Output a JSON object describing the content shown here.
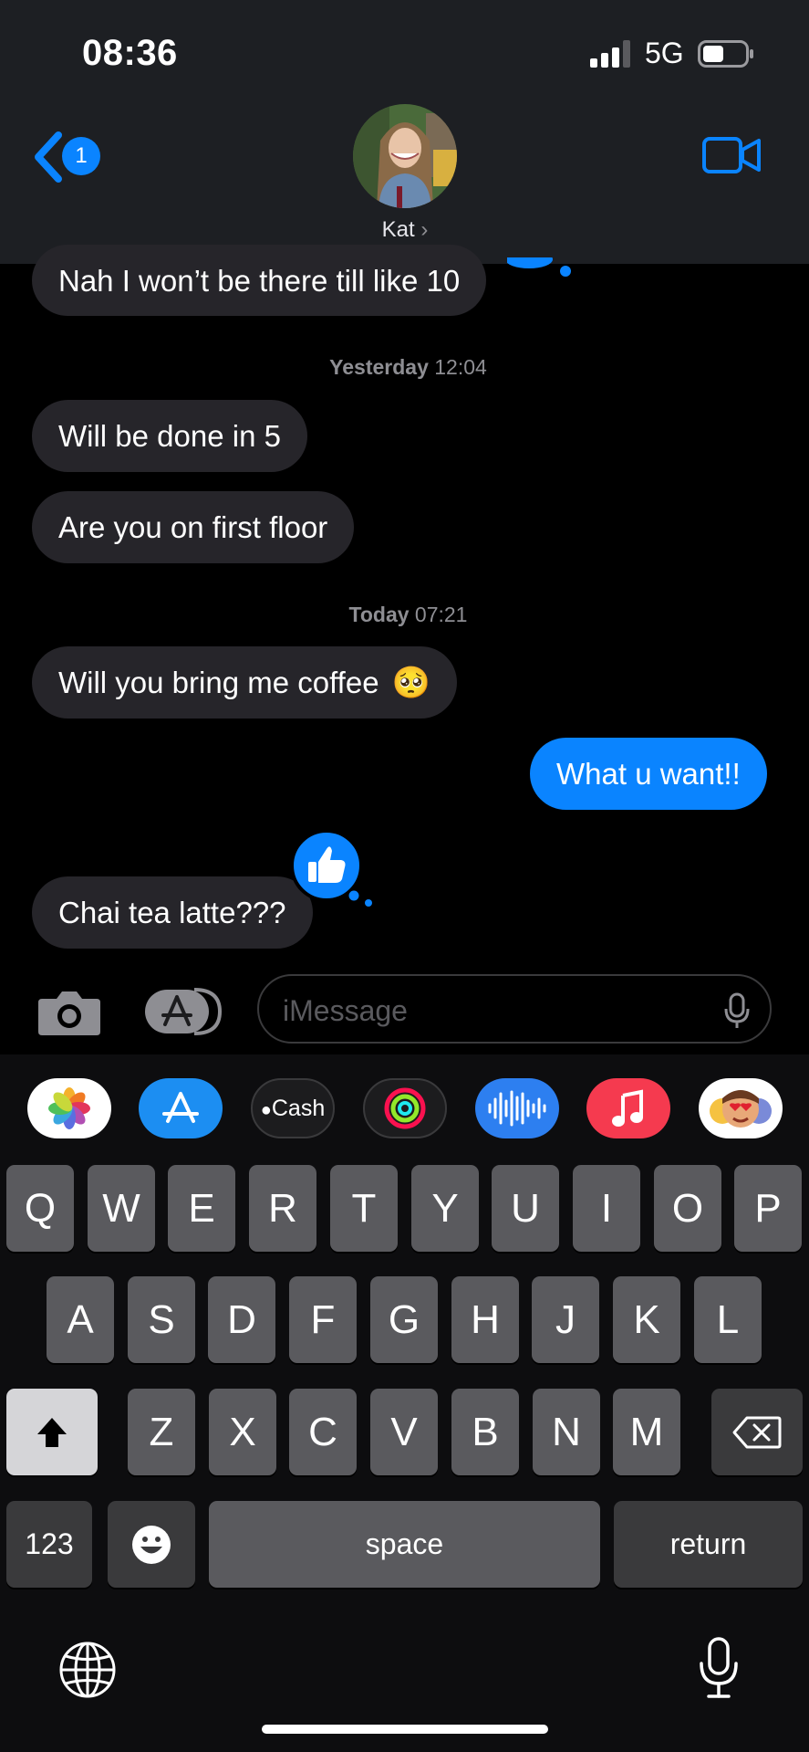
{
  "status_bar": {
    "time": "08:36",
    "network": "5G"
  },
  "header": {
    "back_badge": "1",
    "contact_name": "Kat",
    "contact_chevron": "›"
  },
  "messages": [
    {
      "type": "in",
      "text": "Nah I won’t be there till like 10"
    },
    {
      "type": "stamp",
      "day": "Yesterday",
      "time": "12:04"
    },
    {
      "type": "in",
      "text": "Will be done in 5"
    },
    {
      "type": "in",
      "text": "Are you on first floor"
    },
    {
      "type": "stamp",
      "day": "Today",
      "time": "07:21"
    },
    {
      "type": "in",
      "text": "Will you bring me coffee",
      "emoji": "🥺"
    },
    {
      "type": "out",
      "text": "What u want!!"
    },
    {
      "type": "in",
      "text": "Chai tea latte???",
      "reaction": "thumbs-up-icon"
    }
  ],
  "compose": {
    "placeholder": "iMessage"
  },
  "app_drawer": [
    {
      "name": "photos-app-icon"
    },
    {
      "name": "app-store-icon"
    },
    {
      "name": "apple-cash-icon",
      "label": "Cash"
    },
    {
      "name": "activity-rings-icon"
    },
    {
      "name": "audio-message-icon"
    },
    {
      "name": "music-app-icon"
    },
    {
      "name": "memoji-icon"
    }
  ],
  "keyboard": {
    "row1": [
      "Q",
      "W",
      "E",
      "R",
      "T",
      "Y",
      "U",
      "I",
      "O",
      "P"
    ],
    "row2": [
      "A",
      "S",
      "D",
      "F",
      "G",
      "H",
      "J",
      "K",
      "L"
    ],
    "row3": [
      "Z",
      "X",
      "C",
      "V",
      "B",
      "N",
      "M"
    ],
    "numbers_label": "123",
    "space_label": "space",
    "return_label": "return"
  },
  "colors": {
    "accent": "#0a84ff",
    "incoming_bubble": "#26252a",
    "header_bg": "#1d1f23",
    "key": "#5a5a5e"
  }
}
